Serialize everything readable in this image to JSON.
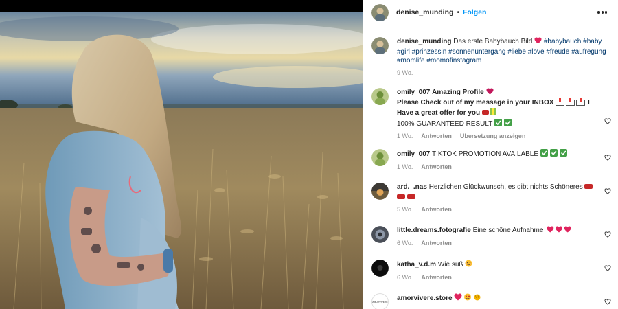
{
  "post": {
    "username": "denise_munding",
    "follow_label": "Folgen",
    "caption_user": "denise_munding",
    "caption_text": "Das erste Babybauch Bild",
    "caption_tags": "#babybauch #baby #girl #prinzessin #sonnenuntergang #liebe #love #freude #aufregung #momlife #momofinstagram",
    "caption_age": "9 Wo."
  },
  "comments": [
    {
      "user": "omily_007",
      "line1": "Amazing Profile",
      "line2a": "Please Check out of my message in your INBOX",
      "line2b": "I",
      "line3": "Have a great offer for you",
      "line4": "100% GUARANTEED RESULT",
      "age": "1 Wo.",
      "reply": "Antworten",
      "translate": "Übersetzung anzeigen"
    },
    {
      "user": "omily_007",
      "text": "TIKTOK PROMOTION AVAILABLE",
      "age": "1 Wo.",
      "reply": "Antworten"
    },
    {
      "user": "ard._.nas",
      "text": "Herzlichen Glückwunsch, es gibt nichts Schöneres",
      "age": "5 Wo.",
      "reply": "Antworten"
    },
    {
      "user": "little.dreams.fotografie",
      "text": "Eine schöne Aufnahme",
      "age": "6 Wo.",
      "reply": "Antworten"
    },
    {
      "user": "katha_v.d.m",
      "text": "Wie süß",
      "age": "6 Wo.",
      "reply": "Antworten"
    },
    {
      "user": "amorvivere.store",
      "avatar_text": "AMORVIVERE"
    }
  ],
  "icons": {
    "more": "more-options-icon",
    "like": "heart-outline-icon"
  },
  "colors": {
    "link": "#0095f6",
    "hashtag": "#00376b",
    "meta": "#8e8e8e",
    "text": "#262626"
  }
}
